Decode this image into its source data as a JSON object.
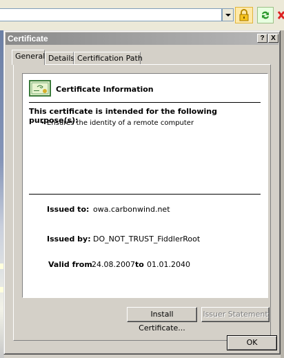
{
  "dialog": {
    "title": "Certificate",
    "help_button": "?",
    "close_button": "X"
  },
  "tabs": [
    {
      "label": "General"
    },
    {
      "label": "Details"
    },
    {
      "label": "Certification Path"
    }
  ],
  "certificate": {
    "heading": "Certificate Information",
    "purpose_title": "This certificate is intended for the following purpose(s):",
    "purposes": [
      "Ensures the identity of a remote computer"
    ],
    "issued_to_label": "Issued to:",
    "issued_to": "owa.carbonwind.net",
    "issued_by_label": "Issued by:",
    "issued_by": "DO_NOT_TRUST_FiddlerRoot",
    "valid_from_label": "Valid from",
    "valid_from": "24.08.2007",
    "valid_to_label": "to",
    "valid_to": "01.01.2040"
  },
  "buttons": {
    "install": "Install Certificate...",
    "issuer_statement": "Issuer Statement",
    "ok": "OK"
  },
  "icons": {
    "lock": "lock-icon",
    "refresh": "refresh-icon",
    "stop": "stop-icon",
    "certificate": "certificate-icon"
  },
  "colors": {
    "dialog_face": "#d4d0c8",
    "titlebar_inactive": "#8a8a8a",
    "panel_white": "#ffffff"
  }
}
